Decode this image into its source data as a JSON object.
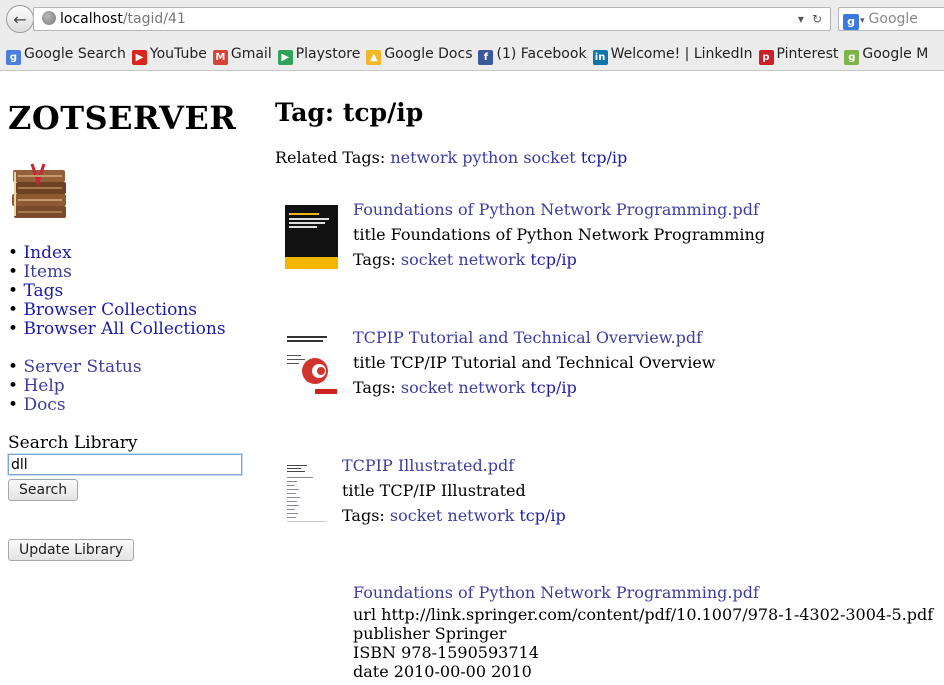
{
  "browser": {
    "url_host": "localhost",
    "url_path": "/tagid/41",
    "search_placeholder": "Google",
    "bookmarks": [
      {
        "label": "Google Search",
        "icon": "google-icon",
        "color": "#4a7fe0",
        "glyph": "g"
      },
      {
        "label": "YouTube",
        "icon": "youtube-icon",
        "color": "#d9251d",
        "glyph": "▶"
      },
      {
        "label": "Gmail",
        "icon": "gmail-icon",
        "color": "#d64337",
        "glyph": "M"
      },
      {
        "label": "Playstore",
        "icon": "playstore-icon",
        "color": "#2fa35a",
        "glyph": "▶"
      },
      {
        "label": "Google Docs",
        "icon": "google-drive-icon",
        "color": "#f3b72b",
        "glyph": "▲"
      },
      {
        "label": "(1) Facebook",
        "icon": "facebook-icon",
        "color": "#3b5998",
        "glyph": "f"
      },
      {
        "label": "Welcome! | LinkedIn",
        "icon": "linkedin-icon",
        "color": "#0e76a8",
        "glyph": "in"
      },
      {
        "label": "Pinterest",
        "icon": "pinterest-icon",
        "color": "#cb2027",
        "glyph": "p"
      },
      {
        "label": "Google M",
        "icon": "google-maps-icon",
        "color": "#7fb34a",
        "glyph": "g"
      }
    ]
  },
  "sidebar": {
    "title": "ZOTSERVER",
    "nav": [
      "Index",
      "Items",
      "Tags",
      "Browser Collections",
      "Browser All Collections"
    ],
    "nav2": [
      "Server Status",
      "Help",
      "Docs"
    ],
    "search_label": "Search Library",
    "search_value": "dll",
    "search_button": "Search",
    "update_button": "Update Library"
  },
  "main": {
    "heading": "Tag: tcp/ip",
    "related_label": "Related Tags:",
    "related_tags": [
      "network",
      "python",
      "socket",
      "tcp/ip"
    ],
    "items": [
      {
        "file": "Foundations of Python Network Programming.pdf",
        "title_line": "title Foundations of Python Network Programming",
        "tags_label": "Tags:",
        "tags": [
          "socket",
          "network",
          "tcp/ip"
        ]
      },
      {
        "file": "TCPIP Tutorial and Technical Overview.pdf",
        "title_line": "title TCP/IP Tutorial and Technical Overview",
        "tags_label": "Tags:",
        "tags": [
          "socket",
          "network",
          "tcp/ip"
        ]
      },
      {
        "file": "TCPIP Illustrated.pdf",
        "title_line": "title TCP/IP Illustrated",
        "tags_label": "Tags:",
        "tags": [
          "socket",
          "network",
          "tcp/ip"
        ]
      }
    ],
    "detail": {
      "file": "Foundations of Python Network Programming.pdf",
      "url": "url http://link.springer.com/content/pdf/10.1007/978-1-4302-3004-5.pdf",
      "publisher": "publisher Springer",
      "isbn": "ISBN 978-1590593714",
      "date": "date 2010-00-00 2010"
    }
  }
}
